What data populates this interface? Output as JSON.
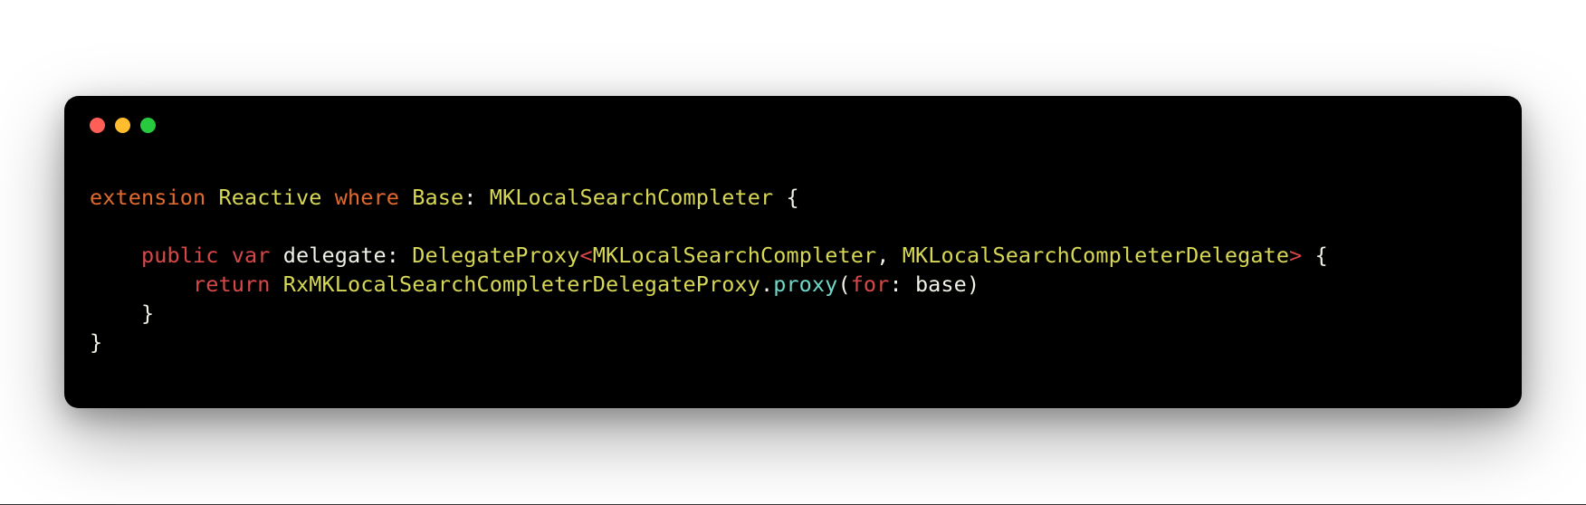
{
  "traffic_lights": {
    "red": "#ff5f56",
    "yellow": "#ffbd2e",
    "green": "#27c93f"
  },
  "code": {
    "line1": {
      "t1": "extension",
      "t2": " ",
      "t3": "Reactive",
      "t4": " ",
      "t5": "where",
      "t6": " ",
      "t7": "Base",
      "t8": ": ",
      "t9": "MKLocalSearchCompleter",
      "t10": " {"
    },
    "line2": "",
    "line3": {
      "t1": "    ",
      "t2": "public",
      "t3": " ",
      "t4": "var",
      "t5": " ",
      "t6": "delegate",
      "t7": ": ",
      "t8": "DelegateProxy",
      "t9": "<",
      "t10": "MKLocalSearchCompleter",
      "t11": ", ",
      "t12": "MKLocalSearchCompleterDelegate",
      "t13": ">",
      "t14": " {"
    },
    "line4": {
      "t1": "        ",
      "t2": "return",
      "t3": " ",
      "t4": "RxMKLocalSearchCompleterDelegateProxy",
      "t5": ".",
      "t6": "proxy",
      "t7": "(",
      "t8": "for",
      "t9": ": ",
      "t10": "base",
      "t11": ")"
    },
    "line5": {
      "t1": "    }"
    },
    "line6": {
      "t1": "}"
    }
  }
}
